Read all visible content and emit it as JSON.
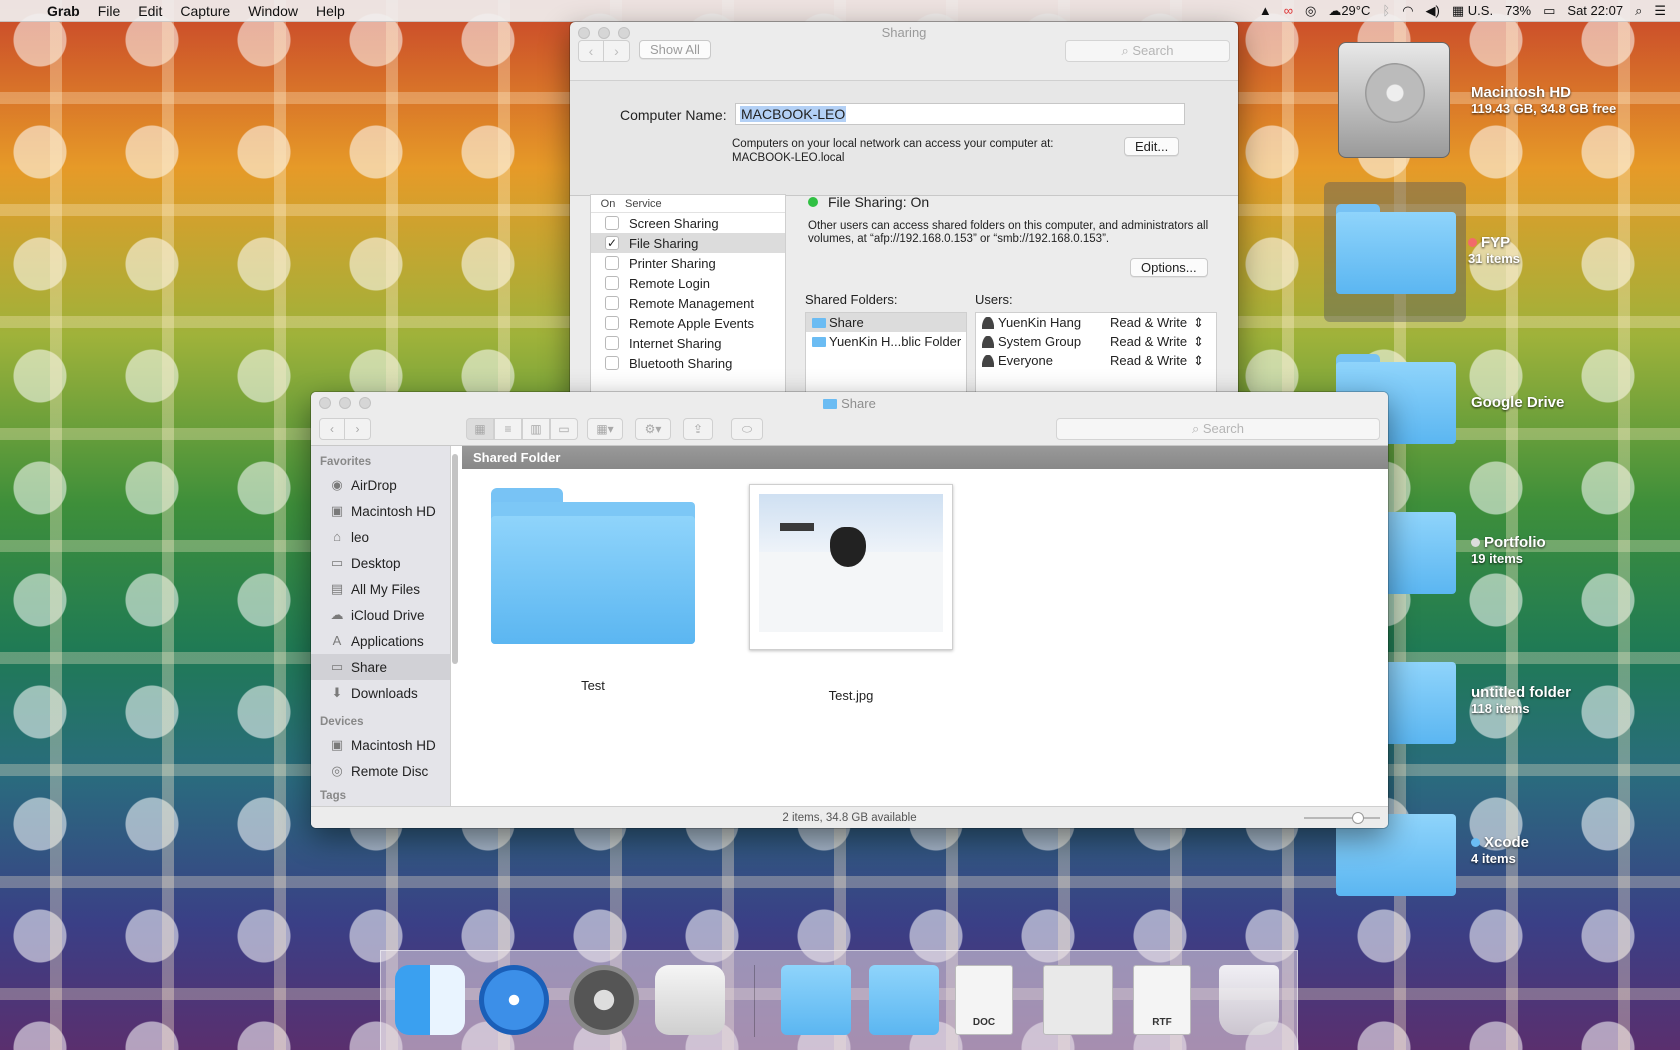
{
  "menubar": {
    "app": "Grab",
    "items": [
      "File",
      "Edit",
      "Capture",
      "Window",
      "Help"
    ],
    "weather": "29°C",
    "input_source": "U.S.",
    "battery": "73%",
    "clock": "Sat 22:07"
  },
  "sharing": {
    "title": "Sharing",
    "show_all": "Show All",
    "search_placeholder": "Search",
    "computer_name_label": "Computer Name:",
    "computer_name": "MACBOOK-LEO",
    "note_line1": "Computers on your local network can access your computer at:",
    "note_line2": "MACBOOK-LEO.local",
    "edit_button": "Edit...",
    "col_on": "On",
    "col_service": "Service",
    "services": [
      {
        "name": "Screen Sharing",
        "checked": ""
      },
      {
        "name": "File Sharing",
        "checked": "✓"
      },
      {
        "name": "Printer Sharing",
        "checked": ""
      },
      {
        "name": "Remote Login",
        "checked": ""
      },
      {
        "name": "Remote Management",
        "checked": ""
      },
      {
        "name": "Remote Apple Events",
        "checked": ""
      },
      {
        "name": "Internet Sharing",
        "checked": ""
      },
      {
        "name": "Bluetooth Sharing",
        "checked": ""
      }
    ],
    "status": "File Sharing: On",
    "description": "Other users can access shared folders on this computer, and administrators all volumes, at “afp://192.168.0.153” or “smb://192.168.0.153”.",
    "options_button": "Options...",
    "shared_folders_label": "Shared Folders:",
    "users_label": "Users:",
    "shared_folders": [
      "Share",
      "YuenKin H...blic Folder"
    ],
    "users": [
      {
        "name": "YuenKin Hang",
        "perm": "Read & Write"
      },
      {
        "name": "System Group",
        "perm": "Read & Write"
      },
      {
        "name": "Everyone",
        "perm": "Read & Write"
      }
    ]
  },
  "finder": {
    "title": "Share",
    "search_placeholder": "Search",
    "favorites_label": "Favorites",
    "favorites": [
      "AirDrop",
      "Macintosh HD",
      "leo",
      "Desktop",
      "All My Files",
      "iCloud Drive",
      "Applications",
      "Share",
      "Downloads"
    ],
    "devices_label": "Devices",
    "devices": [
      "Macintosh HD",
      "Remote Disc"
    ],
    "tags_label": "Tags",
    "path_bar": "Shared Folder",
    "items": [
      {
        "name": "Test",
        "kind": "folder"
      },
      {
        "name": "Test.jpg",
        "kind": "image"
      }
    ],
    "status": "2 items, 34.8 GB available"
  },
  "desktop": {
    "hd_name": "Macintosh HD",
    "hd_info": "119.43 GB, 34.8 GB free",
    "fyp_name": "FYP",
    "fyp_info": "31 items",
    "gdrive_name": "Google Drive",
    "portfolio_name": "Portfolio",
    "portfolio_info": "19 items",
    "untitled_name": "untitled folder",
    "untitled_info": "118 items",
    "xcode_name": "Xcode",
    "xcode_info": "4 items"
  },
  "dock": {
    "doc_label": "DOC",
    "rtf_label": "RTF"
  }
}
